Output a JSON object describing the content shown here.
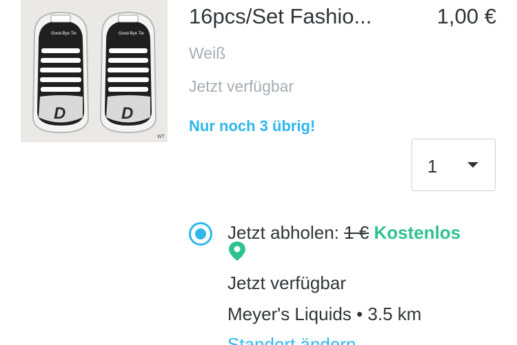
{
  "product": {
    "title": "16pcs/Set Fashio...",
    "price": "1,00 €",
    "variant": "Weiß",
    "availability": "Jetzt verfügbar",
    "stock_note": "Nur noch 3 übrig!",
    "image_alt": "Good-Bye Tie shoelaces package",
    "image_text": {
      "label_left": "Good-Bye Tie",
      "label_right": "Good-Bye Tie",
      "corner": "WT"
    }
  },
  "quantity": {
    "value": "1"
  },
  "pickup": {
    "label": "Jetzt abholen:",
    "old_price": "1 €",
    "free_label": "Kostenlos",
    "availability": "Jetzt verfügbar",
    "store_name": "Meyer's Liquids",
    "separator": "•",
    "distance": "3.5 km",
    "change_link": "Standort ändern",
    "selected": true
  },
  "colors": {
    "accent_blue": "#2fb7ec",
    "accent_green": "#2fc28e",
    "text": "#2f3438",
    "muted": "#a6adb3"
  }
}
